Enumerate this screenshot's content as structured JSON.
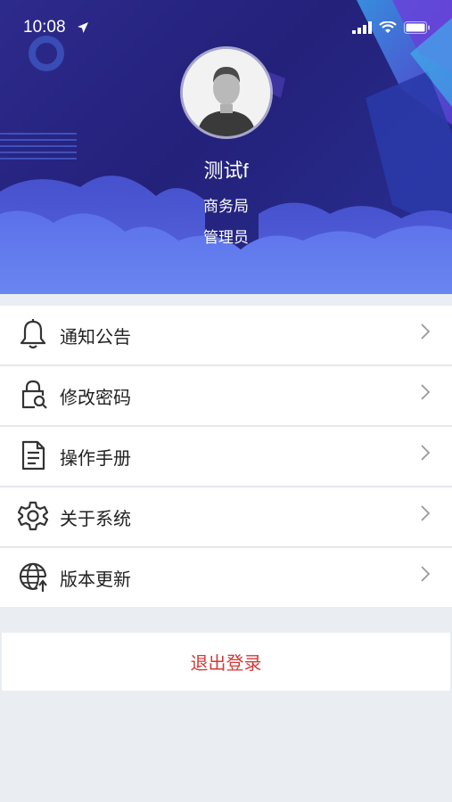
{
  "status_bar": {
    "time": "10:08"
  },
  "profile": {
    "name": "测试f",
    "department": "商务局",
    "role": "管理员"
  },
  "menu": {
    "items": [
      {
        "label": "通知公告",
        "icon": "bell-icon"
      },
      {
        "label": "修改密码",
        "icon": "lock-search-icon"
      },
      {
        "label": "操作手册",
        "icon": "document-icon"
      },
      {
        "label": "关于系统",
        "icon": "gear-icon"
      },
      {
        "label": "版本更新",
        "icon": "globe-upload-icon"
      }
    ]
  },
  "logout": {
    "label": "退出登录"
  },
  "colors": {
    "header": "#2a2a8a",
    "logout_text": "#d33a3a",
    "background": "#eaedf2"
  }
}
